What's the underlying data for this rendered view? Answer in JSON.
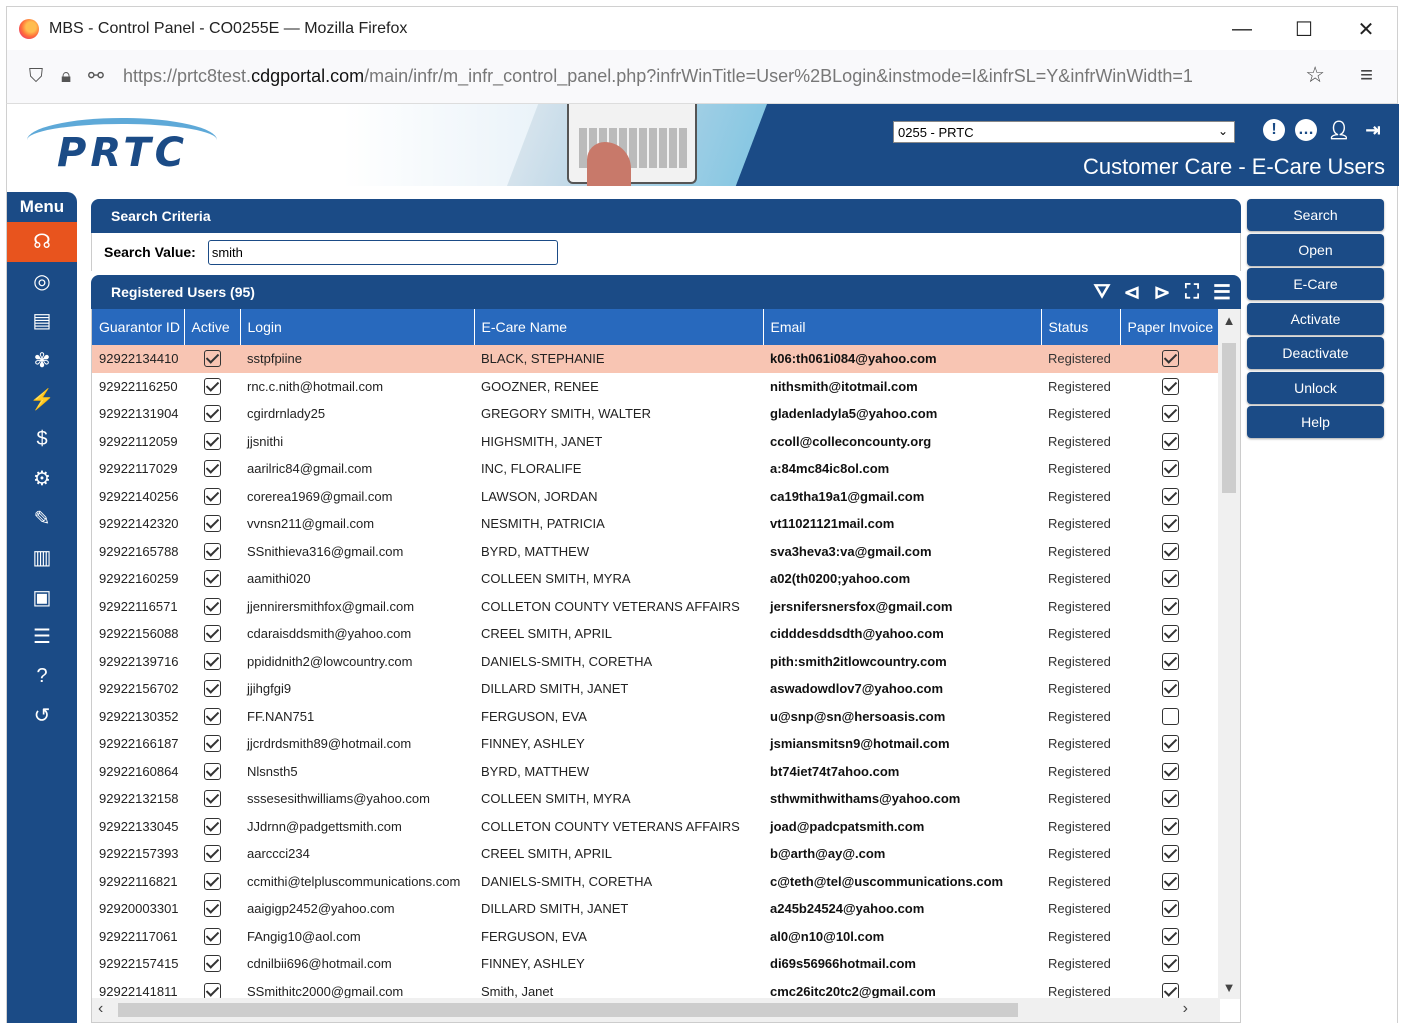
{
  "browser": {
    "title": "MBS - Control Panel - CO0255E — Mozilla Firefox",
    "url_prefix": "https://prtc8test.",
    "url_domain": "cdgportal.com",
    "url_rest": "/main/infr/m_infr_control_panel.php?infrWinTitle=User%2BLogin&instmode=I&infrSL=Y&infrWinWidth=1"
  },
  "header": {
    "logo_text": "PRTC",
    "org_select": "0255 - PRTC",
    "page_title": "Customer Care - E-Care Users"
  },
  "menu": {
    "title": "Menu",
    "items": [
      {
        "icon": "headset-icon",
        "glyph": "☊"
      },
      {
        "icon": "target-icon",
        "glyph": "◎"
      },
      {
        "icon": "calendar-icon",
        "glyph": "▤"
      },
      {
        "icon": "plant-icon",
        "glyph": "✾"
      },
      {
        "icon": "lightning-icon",
        "glyph": "⚡"
      },
      {
        "icon": "dollar-icon",
        "glyph": "$"
      },
      {
        "icon": "gear-icon",
        "glyph": "⚙"
      },
      {
        "icon": "wrench-icon",
        "glyph": "✎"
      },
      {
        "icon": "chart-icon",
        "glyph": "▥"
      },
      {
        "icon": "chip-icon",
        "glyph": "▣"
      },
      {
        "icon": "database-icon",
        "glyph": "☰"
      },
      {
        "icon": "help-icon",
        "glyph": "?"
      },
      {
        "icon": "history-icon",
        "glyph": "↺"
      }
    ]
  },
  "search": {
    "header": "Search Criteria",
    "label": "Search Value:",
    "value": "smith"
  },
  "registered": {
    "header": "Registered Users (95)",
    "columns": [
      "Guarantor ID",
      "Active",
      "Login",
      "E-Care Name",
      "Email",
      "Status",
      "Paper Invoice"
    ],
    "rows": [
      {
        "id": "92922134410",
        "active": true,
        "login": "sstpfpiine",
        "name": "BLACK, STEPHANIE",
        "email": "k06:th061i084@yahoo.com",
        "status": "Registered",
        "paper": true
      },
      {
        "id": "92922116250",
        "active": true,
        "login": "rnc.c.nith@hotmail.com",
        "name": "GOOZNER, RENEE",
        "email": "nithsmith@itotmail.com",
        "status": "Registered",
        "paper": true
      },
      {
        "id": "92922131904",
        "active": true,
        "login": "cgirdrnlady25",
        "name": "GREGORY SMITH, WALTER",
        "email": "gladenladyla5@yahoo.com",
        "status": "Registered",
        "paper": true
      },
      {
        "id": "92922112059",
        "active": true,
        "login": "jjsnithi",
        "name": "HIGHSMITH, JANET",
        "email": "ccoll@colleconcounty.org",
        "status": "Registered",
        "paper": true
      },
      {
        "id": "92922117029",
        "active": true,
        "login": "aarilric84@gmail.com",
        "name": "INC, FLORALIFE",
        "email": "a:84mc84ic8ol.com",
        "status": "Registered",
        "paper": true
      },
      {
        "id": "92922140256",
        "active": true,
        "login": "corerea1969@gmail.com",
        "name": "LAWSON, JORDAN",
        "email": "ca19tha19a1@gmail.com",
        "status": "Registered",
        "paper": true
      },
      {
        "id": "92922142320",
        "active": true,
        "login": "vvnsn211@gmail.com",
        "name": "NESMITH, PATRICIA",
        "email": "vt11021121mail.com",
        "status": "Registered",
        "paper": true
      },
      {
        "id": "92922165788",
        "active": true,
        "login": "SSnithieva316@gmail.com",
        "name": "BYRD, MATTHEW",
        "email": "sva3heva3:va@gmail.com",
        "status": "Registered",
        "paper": true
      },
      {
        "id": "92922160259",
        "active": true,
        "login": "aamithi020",
        "name": "COLLEEN SMITH, MYRA",
        "email": "a02(th0200;yahoo.com",
        "status": "Registered",
        "paper": true
      },
      {
        "id": "92922116571",
        "active": true,
        "login": "jjennirersmithfox@gmail.com",
        "name": "COLLETON COUNTY VETERANS AFFAIRS",
        "email": "jersnifersnersfox@gmail.com",
        "status": "Registered",
        "paper": true
      },
      {
        "id": "92922156088",
        "active": true,
        "login": "cdaraisddsmith@yahoo.com",
        "name": "CREEL SMITH, APRIL",
        "email": "cidddesddsdth@yahoo.com",
        "status": "Registered",
        "paper": true
      },
      {
        "id": "92922139716",
        "active": true,
        "login": "ppididnith2@lowcountry.com",
        "name": "DANIELS-SMITH, CORETHA",
        "email": "pith:smith2itlowcountry.com",
        "status": "Registered",
        "paper": true
      },
      {
        "id": "92922156702",
        "active": true,
        "login": "jjihgfgi9",
        "name": "DILLARD SMITH, JANET",
        "email": "aswadowdlov7@yahoo.com",
        "status": "Registered",
        "paper": true
      },
      {
        "id": "92922130352",
        "active": true,
        "login": "FF.NAN751",
        "name": "FERGUSON, EVA",
        "email": "u@snp@sn@hersoasis.com",
        "status": "Registered",
        "paper": false
      },
      {
        "id": "92922166187",
        "active": true,
        "login": "jjcrdrdsmith89@hotmail.com",
        "name": "FINNEY, ASHLEY",
        "email": "jsmiansmitsn9@hotmail.com",
        "status": "Registered",
        "paper": true
      },
      {
        "id": "92922160864",
        "active": true,
        "login": "Nlsnsth5",
        "name": "BYRD, MATTHEW",
        "email": "bt74iet74t7ahoo.com",
        "status": "Registered",
        "paper": true
      },
      {
        "id": "92922132158",
        "active": true,
        "login": "sssesesithwilliams@yahoo.com",
        "name": "COLLEEN SMITH, MYRA",
        "email": "sthwmithwithams@yahoo.com",
        "status": "Registered",
        "paper": true
      },
      {
        "id": "92922133045",
        "active": true,
        "login": "JJdrnn@padgettsmith.com",
        "name": "COLLETON COUNTY VETERANS AFFAIRS",
        "email": "joad@padcpatsmith.com",
        "status": "Registered",
        "paper": true
      },
      {
        "id": "92922157393",
        "active": true,
        "login": "aarccci234",
        "name": "CREEL SMITH, APRIL",
        "email": "b@arth@ay@.com",
        "status": "Registered",
        "paper": true
      },
      {
        "id": "92922116821",
        "active": true,
        "login": "ccmithi@telpluscommunications.com",
        "name": "DANIELS-SMITH, CORETHA",
        "email": "c@teth@tel@uscommunications.com",
        "status": "Registered",
        "paper": true
      },
      {
        "id": "92920003301",
        "active": true,
        "login": "aaigigp2452@yahoo.com",
        "name": "DILLARD SMITH, JANET",
        "email": "a245b24524@yahoo.com",
        "status": "Registered",
        "paper": true
      },
      {
        "id": "92922117061",
        "active": true,
        "login": "FAngig10@aol.com",
        "name": "FERGUSON, EVA",
        "email": "al0@n10@10l.com",
        "status": "Registered",
        "paper": true
      },
      {
        "id": "92922157415",
        "active": true,
        "login": "cdnilbii696@hotmail.com",
        "name": "FINNEY, ASHLEY",
        "email": "di69s56966hotmail.com",
        "status": "Registered",
        "paper": true
      },
      {
        "id": "92922141811",
        "active": true,
        "login": "SSmithitc2000@gmail.com",
        "name": "Smith, Janet",
        "email": "cmc26itc20tc2@gmail.com",
        "status": "Registered",
        "paper": true
      }
    ]
  },
  "actions": [
    "Search",
    "Open",
    "E-Care",
    "Activate",
    "Deactivate",
    "Unlock",
    "Help"
  ],
  "colors": {
    "brand": "#1b4b86",
    "grid_header": "#2869bd",
    "active_menu": "#e8541e",
    "selected_row": "#f8c5b3"
  }
}
